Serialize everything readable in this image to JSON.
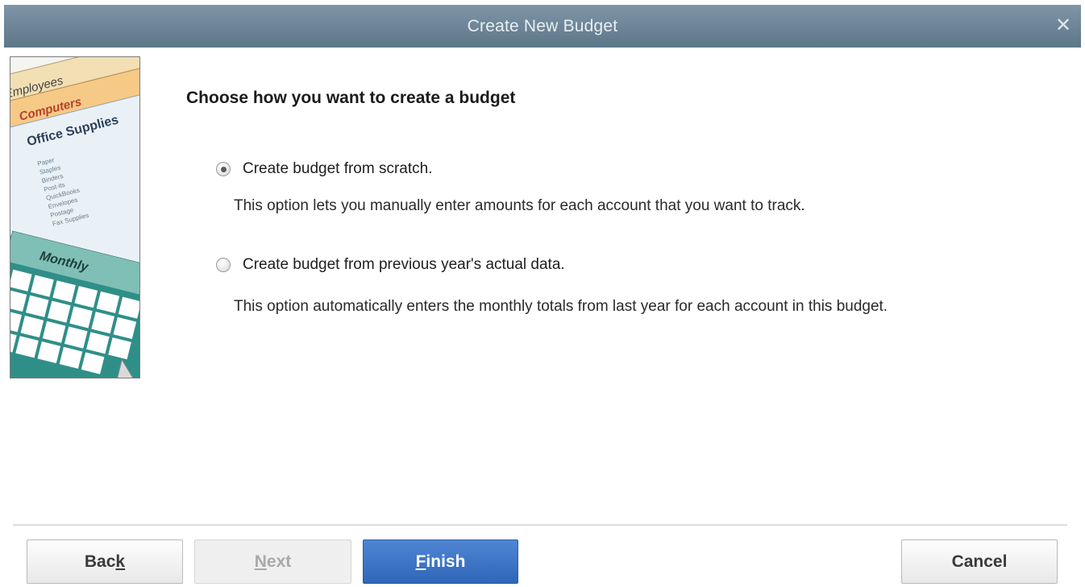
{
  "window": {
    "title": "Create New Budget",
    "close_icon": "close-icon"
  },
  "illustration": {
    "tabs": [
      "Employees",
      "Computers",
      "Office Supplies"
    ],
    "list_items": [
      "Paper",
      "Staples",
      "Binders",
      "Post-its",
      "QuickBooks",
      "Envelopes",
      "Postage",
      "Fax Supplies"
    ],
    "calendar_label": "Monthly"
  },
  "main": {
    "heading": "Choose how you want to create a budget",
    "options": [
      {
        "label": "Create budget from scratch.",
        "description": "This option lets you manually enter amounts for each account that you want to track.",
        "selected": true
      },
      {
        "label": "Create budget from previous year's actual data.",
        "description": "This option automatically enters the monthly totals from last year for each account in this budget.",
        "selected": false
      }
    ]
  },
  "footer": {
    "back_prefix": "Bac",
    "back_mnemonic": "k",
    "next_mnemonic": "N",
    "next_suffix": "ext",
    "finish_mnemonic": "F",
    "finish_suffix": "inish",
    "cancel_label": "Cancel"
  },
  "colors": {
    "titlebar": "#6f879a",
    "finish_button": "#3d74c6"
  }
}
